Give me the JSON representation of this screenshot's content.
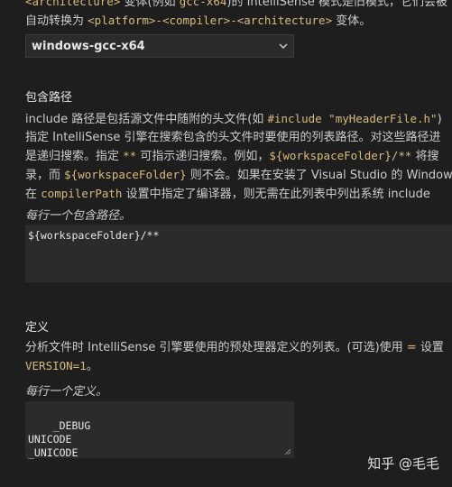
{
  "platform_section": {
    "line1_prefix": "<architecture>",
    "line1_text": " 变体(例如 ",
    "line1_code": "gcc-x64",
    "line1_rest": ")的 IntelliSense 模式是旧模式，它们会被",
    "line2_text": "自动转换为 ",
    "line2_code1": "<platform>",
    "line2_sep1": "-",
    "line2_code2": "<compiler>",
    "line2_sep2": "-",
    "line2_code3": "<architecture>",
    "line2_end": " 变体。",
    "select_value": "windows-gcc-x64"
  },
  "include_section": {
    "heading": "包含路径",
    "d1a": "include 路径是包括源文件中随附的头文件(如 ",
    "d1code": "#include \"myHeaderFile.h\"",
    "d1b": ")",
    "d2": "指定 IntelliSense 引擎在搜索包含的头文件时要使用的列表路径。对这些路径进",
    "d3a": "是递归搜索。指定 ",
    "d3code1": "**",
    "d3b": " 可指示递归搜索。例如，",
    "d3code2": "${workspaceFolder}/**",
    "d3c": " 将搜",
    "d4a": "录，而 ",
    "d4code": "${workspaceFolder}",
    "d4b": " 则不会。如果在安装了 Visual Studio 的 Windows",
    "d5a": "在 ",
    "d5code": "compilerPath",
    "d5b": " 设置中指定了编译器，则无需在此列表中列出系统 include",
    "label": "每行一个包含路径。",
    "value": "${workspaceFolder}/**"
  },
  "defines_section": {
    "heading": "定义",
    "d1a": "分析文件时 IntelliSense 引擎要使用的预处理器定义的列表。(可选)使用 ",
    "d1op": "=",
    "d1b": " 设置",
    "d2code": "VERSION=1",
    "d2b": "。",
    "label": "每行一个定义。",
    "value": "_DEBUG\nUNICODE\n_UNICODE"
  },
  "watermark": "知乎 @毛毛",
  "icons": {
    "select_chevron": "chevron-down-icon",
    "resize": "resize-handle-icon"
  },
  "colors": {
    "background": "#1e1e1e",
    "code": "#d7ba7d",
    "input_bg": "#2b2b2b"
  }
}
